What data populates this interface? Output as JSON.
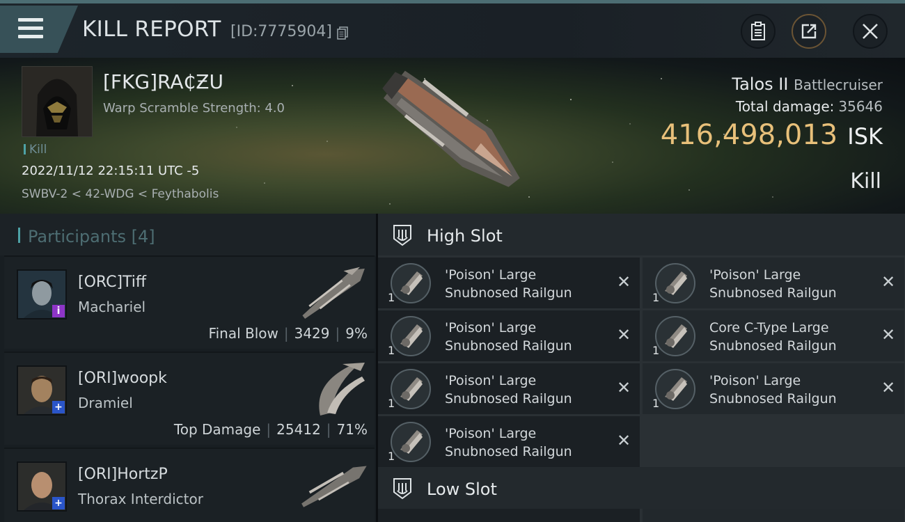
{
  "topbar": {
    "title": "KILL REPORT",
    "kill_id": "[ID:7775904]",
    "icons": {
      "menu": "menu-icon",
      "copy": "copy-icon",
      "clipboard": "clipboard-icon",
      "share": "share-icon",
      "close": "close-icon"
    }
  },
  "victim": {
    "pilot_name": "[FKG]RA₵ƵU",
    "warp_scramble": "Warp Scramble Strength: 4.0",
    "result_tag": "Kill",
    "datetime": "2022/11/12 22:15:11 UTC -5",
    "location": "SWBV-2 < 42-WDG < Feythabolis",
    "ship": "Talos II",
    "ship_class": "Battlecruiser",
    "total_damage_label": "Total damage:",
    "total_damage": "35646",
    "isk_value": "416,498,013",
    "isk_unit": "ISK",
    "outcome": "Kill"
  },
  "participants": {
    "title": "Participants",
    "count": "[4]",
    "items": [
      {
        "name": "[ORC]Tiff",
        "ship": "Machariel",
        "role": "Final Blow",
        "damage": "3429",
        "percent": "9%",
        "badge": "i",
        "badge_color": "#8e35c7"
      },
      {
        "name": "[ORI]woopk",
        "ship": "Dramiel",
        "role": "Top Damage",
        "damage": "25412",
        "percent": "71%",
        "badge": "+",
        "badge_color": "#2a55c9"
      },
      {
        "name": "[ORI]HortzP",
        "ship": "Thorax Interdictor",
        "badge": "+",
        "badge_color": "#2a55c9"
      }
    ]
  },
  "fitting": {
    "high_slot_title": "High Slot",
    "low_slot_title": "Low Slot",
    "high_slot_modules": [
      {
        "line1": "'Poison' Large",
        "line2": "Snubnosed Railgun",
        "qty": "1"
      },
      {
        "line1": "'Poison' Large",
        "line2": "Snubnosed Railgun",
        "qty": "1"
      },
      {
        "line1": "'Poison' Large",
        "line2": "Snubnosed Railgun",
        "qty": "1"
      },
      {
        "line1": "Core C-Type Large",
        "line2": "Snubnosed Railgun",
        "qty": "1"
      },
      {
        "line1": "'Poison' Large",
        "line2": "Snubnosed Railgun",
        "qty": "1"
      },
      {
        "line1": "'Poison' Large",
        "line2": "Snubnosed Railgun",
        "qty": "1"
      },
      {
        "line1": "'Poison' Large",
        "line2": "Snubnosed Railgun",
        "qty": "1"
      }
    ]
  },
  "colors": {
    "accent_teal": "#4ea2a6",
    "isk_gold": "#e8c07a",
    "panel": "#181e22"
  }
}
